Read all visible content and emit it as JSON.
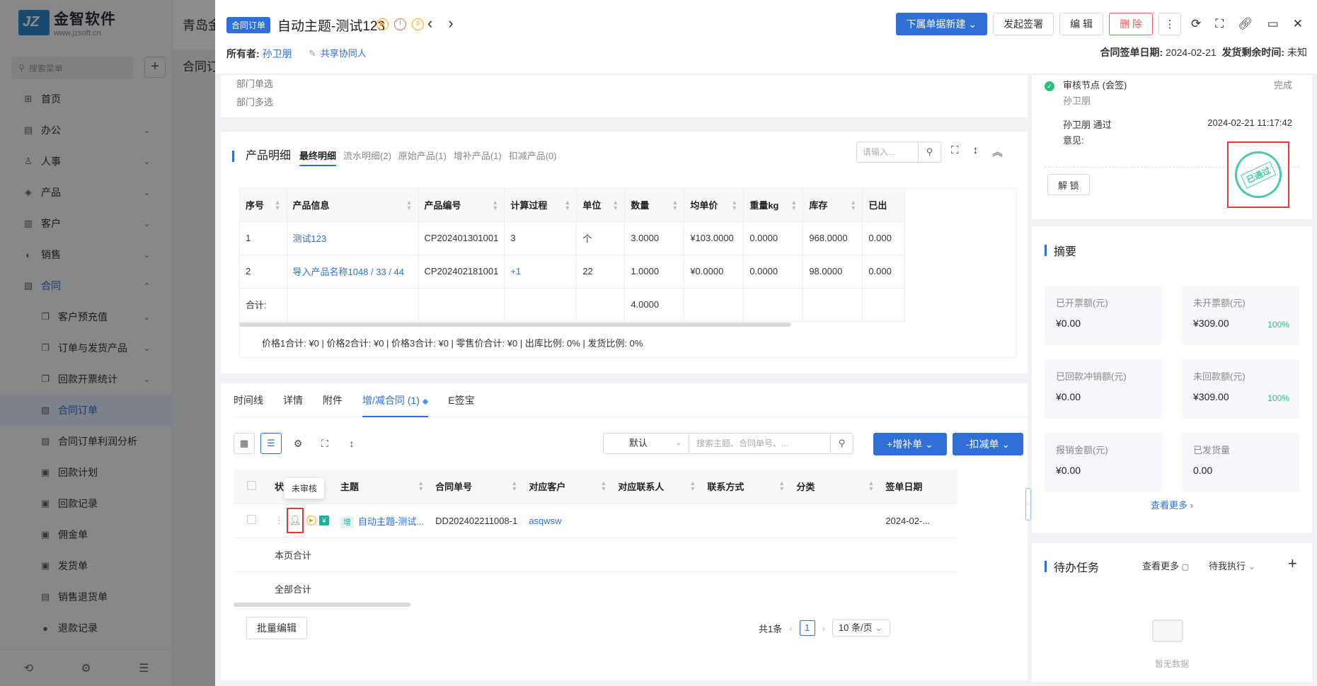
{
  "bg": {
    "logo_name": "金智软件",
    "logo_url": "www.jzsoft.cn",
    "search_placeholder": "搜索菜单",
    "title": "青岛金",
    "subtitle": "合同订",
    "menu": [
      {
        "label": "首页",
        "icon": "home-icon",
        "glyph": "⊞"
      },
      {
        "label": "办公",
        "icon": "office-icon",
        "glyph": "▤",
        "arrow": "⌄"
      },
      {
        "label": "人事",
        "icon": "people-icon",
        "glyph": "♙",
        "arrow": "⌄"
      },
      {
        "label": "产品",
        "icon": "product-icon",
        "glyph": "◈",
        "arrow": "⌄"
      },
      {
        "label": "客户",
        "icon": "customer-icon",
        "glyph": "▥",
        "arrow": "⌄"
      },
      {
        "label": "销售",
        "icon": "sales-icon",
        "glyph": "◐",
        "arrow": "⌄"
      },
      {
        "label": "合同",
        "icon": "contract-icon",
        "glyph": "▧",
        "arrow": "⌃",
        "active_parent": true
      },
      {
        "label": "客户预充值",
        "icon": "doc-icon",
        "glyph": "❐",
        "arrow": "⌄",
        "sub": true
      },
      {
        "label": "订单与发货产品",
        "icon": "doc-icon",
        "glyph": "❐",
        "arrow": "⌄",
        "sub": true
      },
      {
        "label": "回款开票统计",
        "icon": "doc-icon",
        "glyph": "❐",
        "arrow": "⌄",
        "sub": true
      },
      {
        "label": "合同订单",
        "icon": "doc-icon",
        "glyph": "▧",
        "sub": true,
        "active": true
      },
      {
        "label": "合同订单利润分析",
        "icon": "doc-icon",
        "glyph": "▧",
        "sub": true
      },
      {
        "label": "回款计划",
        "icon": "doc-icon",
        "glyph": "▣",
        "sub": true
      },
      {
        "label": "回款记录",
        "icon": "doc-icon",
        "glyph": "▣",
        "sub": true
      },
      {
        "label": "佣金单",
        "icon": "doc-icon",
        "glyph": "▣",
        "sub": true
      },
      {
        "label": "发货单",
        "icon": "doc-icon",
        "glyph": "▣",
        "sub": true
      },
      {
        "label": "销售退货单",
        "icon": "doc-icon",
        "glyph": "▤",
        "sub": true
      },
      {
        "label": "退款记录",
        "icon": "doc-icon",
        "glyph": "●",
        "sub": true
      }
    ]
  },
  "header": {
    "tag": "合同订单",
    "title": "自动主题-测试123",
    "owner_label": "所有者:",
    "owner": "孙卫朋",
    "collab": "共享协同人",
    "buttons": {
      "new_child": "下属单据新建",
      "sign": "发起签署",
      "edit": "编 辑",
      "delete": "删 除"
    },
    "sign_date_label": "合同签单日期:",
    "sign_date": "2024-02-21",
    "ship_label": "发货剩余时间:",
    "ship_value": "未知"
  },
  "dept": {
    "single": "部门单选",
    "multi": "部门多选"
  },
  "products": {
    "title": "产品明细",
    "tabs": [
      "最终明细",
      "流水明细(2)",
      "原始产品(1)",
      "增补产品(1)",
      "扣减产品(0)"
    ],
    "search_placeholder": "请输入...",
    "columns": [
      "序号",
      "产品信息",
      "产品编号",
      "计算过程",
      "单位",
      "数量",
      "均单价",
      "重量kg",
      "库存",
      "已出"
    ],
    "rows": [
      [
        "1",
        "测试123",
        "CP202401301001",
        "3",
        "个",
        "3.0000",
        "¥103.0000",
        "0.0000",
        "968.0000",
        "0.000"
      ],
      [
        "2",
        "导入产品名称1048 / 33 / 44",
        "CP202402181001",
        "+1",
        "22",
        "1.0000",
        "¥0.0000",
        "0.0000",
        "98.0000",
        "0.000"
      ]
    ],
    "total_label": "合计:",
    "total_qty": "4.0000",
    "footer": "价格1合计: ¥0 |   价格2合计: ¥0 |   价格3合计: ¥0 |   零售价合计: ¥0 |   出库比例: 0% |   发货比例: 0%"
  },
  "contract": {
    "tabs": [
      "时间线",
      "详情",
      "附件",
      "增/减合同 (1)",
      "E签宝"
    ],
    "select_value": "默认",
    "search_placeholder": "搜索主题、合同单号、...",
    "add_label": "+增补单",
    "sub_label": "-扣减单",
    "columns": [
      "状",
      "主题",
      "合同单号",
      "对应客户",
      "对应联系人",
      "联系方式",
      "分类",
      "签单日期"
    ],
    "row": {
      "tag": "增",
      "subject": "自动主题-测试...",
      "number": "DD202402211008-1",
      "customer": "asqwsw",
      "sign_date": "2024-02-..."
    },
    "page_total": "本页合计",
    "all_total": "全部合计",
    "tooltip": "未审核",
    "batch": "批量编辑",
    "count": "共1条",
    "page": "1",
    "page_size": "10 条/页"
  },
  "approval": {
    "node": "审核节点 (会签)",
    "node_user": "孙卫朋",
    "node_status": "完成",
    "pass": "孙卫朋 通过",
    "time": "2024-02-21 11:17:42",
    "opinion": "意见:",
    "unlock": "解 锁",
    "stamp": "已通过"
  },
  "summary": {
    "title": "摘要",
    "tiles": [
      {
        "label": "已开票额(元)",
        "value": "¥0.00"
      },
      {
        "label": "未开票额(元)",
        "value": "¥309.00",
        "pct": "100%"
      },
      {
        "label": "已回款冲销额(元)",
        "value": "¥0.00"
      },
      {
        "label": "未回款额(元)",
        "value": "¥309.00",
        "pct": "100%"
      },
      {
        "label": "报销金额(元)",
        "value": "¥0.00"
      },
      {
        "label": "已发货量",
        "value": "0.00"
      }
    ],
    "more": "查看更多"
  },
  "todo": {
    "title": "待办任务",
    "more": "查看更多",
    "filter": "待我执行",
    "empty": "暂无数据"
  },
  "colors": {
    "primary": "#2f6fd6",
    "danger": "#f15d5d",
    "success": "#2cbf7a"
  }
}
